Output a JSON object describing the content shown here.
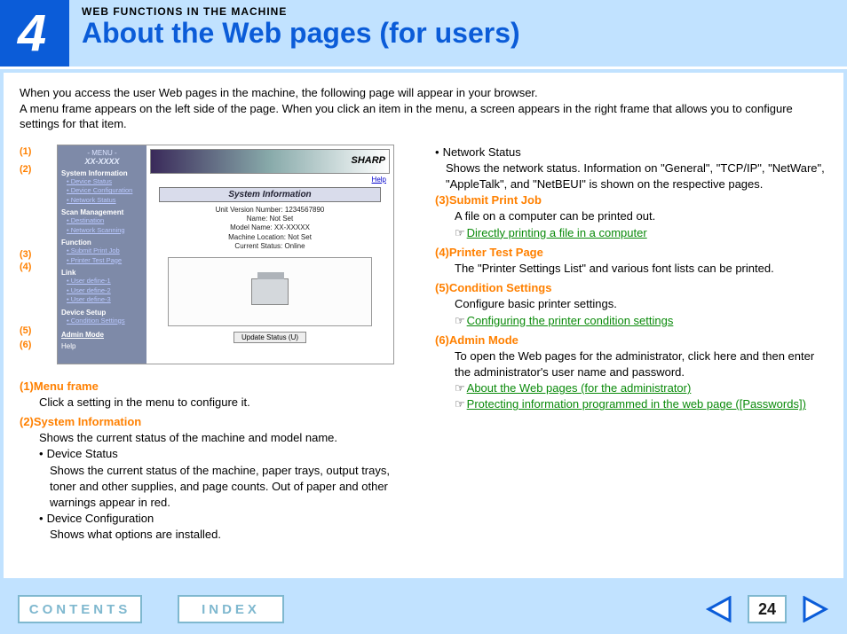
{
  "header": {
    "chapter_number": "4",
    "section_label": "WEB FUNCTIONS IN THE MACHINE",
    "title": "About the Web pages (for users)"
  },
  "intro": "When you access the user Web pages in the machine, the following page will appear in your browser.\nA menu frame appears on the left side of the page. When you click an item in the menu, a screen appears in the right frame that allows you to configure settings for that item.",
  "callouts": [
    "(1)",
    "(2)",
    "(3)",
    "(4)",
    "(5)",
    "(6)"
  ],
  "screenshot": {
    "menu_header": "- MENU -",
    "model": "XX-XXXX",
    "groups": [
      {
        "title": "System Information",
        "items": [
          "Device Status",
          "Device Configuration",
          "Network Status"
        ]
      },
      {
        "title": "Scan Management",
        "items": [
          "Destination",
          "Network Scanning"
        ]
      },
      {
        "title": "Function",
        "items": [
          "Submit Print Job",
          "Printer Test Page"
        ]
      },
      {
        "title": "Link",
        "items": [
          "User define-1",
          "User define-2",
          "User define-3"
        ]
      },
      {
        "title": "Device Setup",
        "items": [
          "Condition Settings"
        ]
      }
    ],
    "admin_mode": "Admin Mode",
    "help": "Help",
    "brand": "SHARP",
    "main_help": "Help",
    "panel_title": "System Information",
    "info_lines": "Unit Version Number: 1234567890\nName: Not Set\nModel Name: XX-XXXXX\nMachine Location: Not Set\nCurrent Status: Online",
    "update_btn": "Update Status (U)"
  },
  "left_items": [
    {
      "num": "(1)",
      "title": "Menu frame",
      "body": "Click a setting in the menu to configure it."
    },
    {
      "num": "(2)",
      "title": "System Information",
      "body": "Shows the current status of the machine and model name.",
      "bullets": [
        {
          "h": "Device Status",
          "d": "Shows the current status of the machine, paper trays, output trays, toner and other supplies, and page counts. Out of paper and other warnings appear in red."
        },
        {
          "h": "Device Configuration",
          "d": "Shows what options are installed."
        }
      ]
    }
  ],
  "right_items_pre": {
    "h": "Network Status",
    "d": "Shows the network status. Information on \"General\", \"TCP/IP\", \"NetWare\", \"AppleTalk\", and \"NetBEUI\" is shown on the respective pages."
  },
  "right_items": [
    {
      "num": "(3)",
      "title": "Submit Print Job",
      "body": "A file on a computer can be printed out.",
      "links": [
        "Directly printing a file in a computer"
      ]
    },
    {
      "num": "(4)",
      "title": "Printer Test Page",
      "body": "The \"Printer Settings List\" and various font lists can be printed."
    },
    {
      "num": "(5)",
      "title": "Condition Settings",
      "body": "Configure basic printer settings.",
      "links": [
        "Configuring the printer condition settings"
      ]
    },
    {
      "num": "(6)",
      "title": "Admin Mode",
      "body": "To open the Web pages for the administrator, click here and then enter the administrator's user name and password.",
      "links": [
        "About the Web pages (for the administrator)",
        "Protecting information programmed in the web page ([Passwords])"
      ]
    }
  ],
  "footer": {
    "contents": "CONTENTS",
    "index": "INDEX",
    "page_number": "24"
  }
}
